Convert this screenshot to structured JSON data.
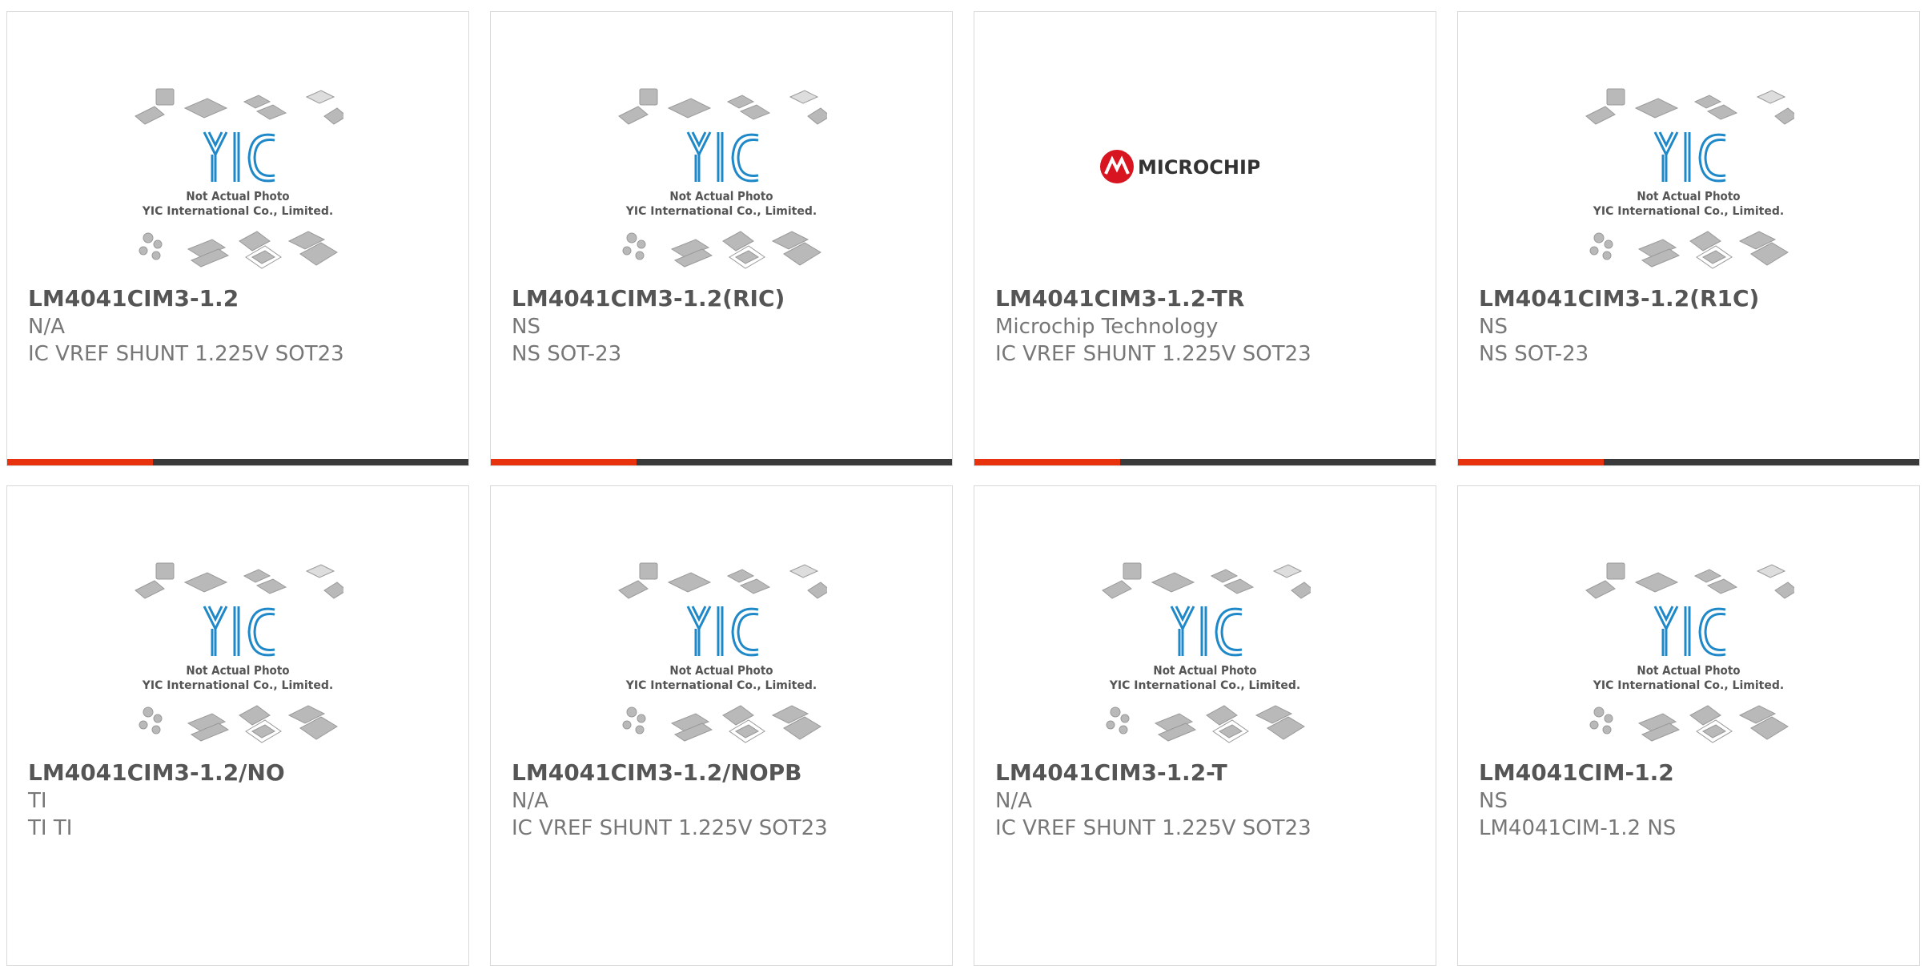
{
  "colors": {
    "accent": "#e8320e",
    "bar": "#3a3a3a",
    "yic_blue": "#1e88c8",
    "microchip_red": "#d7141f"
  },
  "placeholder": {
    "line1": "Not Actual Photo",
    "line2": "YIC International Co., Limited."
  },
  "microchip_logo": {
    "text": "Microchip"
  },
  "products": [
    {
      "part_number": "LM4041CIM3-1.2",
      "manufacturer": "N/A",
      "description": "IC VREF SHUNT 1.225V SOT23",
      "image": "yic"
    },
    {
      "part_number": "LM4041CIM3-1.2(RIC)",
      "manufacturer": "NS",
      "description": "NS SOT-23",
      "image": "yic"
    },
    {
      "part_number": "LM4041CIM3-1.2-TR",
      "manufacturer": "Microchip Technology",
      "description": "IC VREF SHUNT 1.225V SOT23",
      "image": "microchip"
    },
    {
      "part_number": "LM4041CIM3-1.2(R1C)",
      "manufacturer": "NS",
      "description": "NS SOT-23",
      "image": "yic"
    },
    {
      "part_number": "LM4041CIM3-1.2/NO",
      "manufacturer": "TI",
      "description": "TI TI",
      "image": "yic"
    },
    {
      "part_number": "LM4041CIM3-1.2/NOPB",
      "manufacturer": "N/A",
      "description": "IC VREF SHUNT 1.225V SOT23",
      "image": "yic"
    },
    {
      "part_number": "LM4041CIM3-1.2-T",
      "manufacturer": "N/A",
      "description": "IC VREF SHUNT 1.225V SOT23",
      "image": "yic"
    },
    {
      "part_number": "LM4041CIM-1.2",
      "manufacturer": "NS",
      "description": "LM4041CIM-1.2 NS",
      "image": "yic"
    }
  ]
}
